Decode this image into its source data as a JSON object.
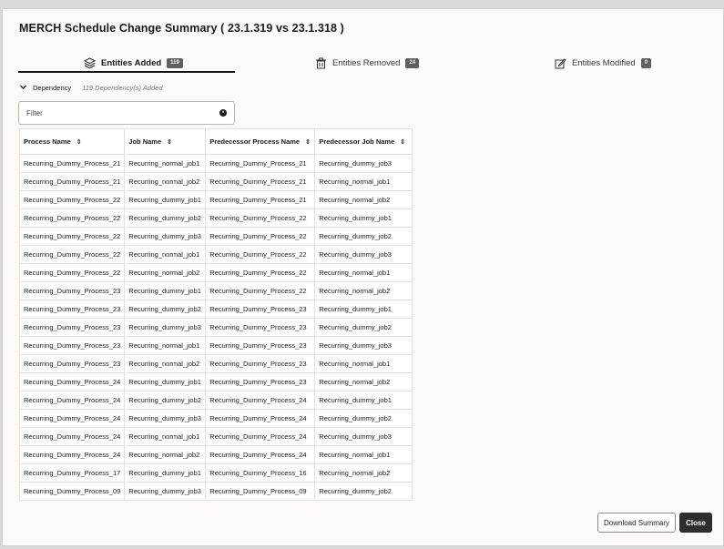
{
  "dialog": {
    "title": "MERCH Schedule Change Summary ( 23.1.319 vs 23.1.318 )"
  },
  "tabs": [
    {
      "label": "Entities Added",
      "badge": "119",
      "icon": "layers-icon",
      "active": true
    },
    {
      "label": "Entities Removed",
      "badge": "24",
      "icon": "trash-icon",
      "active": false
    },
    {
      "label": "Entities Modified",
      "badge": "0",
      "icon": "edit-icon",
      "active": false
    }
  ],
  "section": {
    "label": "Dependency",
    "count_text": "119 Dependency(s) Added",
    "icon": "chevron-down-icon"
  },
  "filter": {
    "placeholder": "Filter",
    "icon": "clear-icon"
  },
  "table": {
    "headers": [
      "Process Name",
      "Job Name",
      "Predecessor Process Name",
      "Predecessor Job Name"
    ],
    "rows": [
      [
        "Recurring_Dummy_Process_21",
        "Recurring_normal_job1",
        "Recurring_Dummy_Process_21",
        "Recurring_dummy_job3"
      ],
      [
        "Recurring_Dummy_Process_21",
        "Recurring_normal_job2",
        "Recurring_Dummy_Process_21",
        "Recurring_normal_job1"
      ],
      [
        "Recurring_Dummy_Process_22",
        "Recurring_dummy_job1",
        "Recurring_Dummy_Process_21",
        "Recurring_normal_job2"
      ],
      [
        "Recurring_Dummy_Process_22",
        "Recurring_dummy_job2",
        "Recurring_Dummy_Process_22",
        "Recurring_dummy_job1"
      ],
      [
        "Recurring_Dummy_Process_22",
        "Recurring_dummy_job3",
        "Recurring_Dummy_Process_22",
        "Recurring_dummy_job2"
      ],
      [
        "Recurring_Dummy_Process_22",
        "Recurring_normal_job1",
        "Recurring_Dummy_Process_22",
        "Recurring_dummy_job3"
      ],
      [
        "Recurring_Dummy_Process_22",
        "Recurring_normal_job2",
        "Recurring_Dummy_Process_22",
        "Recurring_normal_job1"
      ],
      [
        "Recurring_Dummy_Process_23",
        "Recurring_dummy_job1",
        "Recurring_Dummy_Process_22",
        "Recurring_normal_job2"
      ],
      [
        "Recurring_Dummy_Process_23",
        "Recurring_dummy_job2",
        "Recurring_Dummy_Process_23",
        "Recurring_dummy_job1"
      ],
      [
        "Recurring_Dummy_Process_23",
        "Recurring_dummy_job3",
        "Recurring_Dummy_Process_23",
        "Recurring_dummy_job2"
      ],
      [
        "Recurring_Dummy_Process_23",
        "Recurring_normal_job1",
        "Recurring_Dummy_Process_23",
        "Recurring_dummy_job3"
      ],
      [
        "Recurring_Dummy_Process_23",
        "Recurring_normal_job2",
        "Recurring_Dummy_Process_23",
        "Recurring_normal_job1"
      ],
      [
        "Recurring_Dummy_Process_24",
        "Recurring_dummy_job1",
        "Recurring_Dummy_Process_23",
        "Recurring_normal_job2"
      ],
      [
        "Recurring_Dummy_Process_24",
        "Recurring_dummy_job2",
        "Recurring_Dummy_Process_24",
        "Recurring_dummy_job1"
      ],
      [
        "Recurring_Dummy_Process_24",
        "Recurring_dummy_job3",
        "Recurring_Dummy_Process_24",
        "Recurring_dummy_job2"
      ],
      [
        "Recurring_Dummy_Process_24",
        "Recurring_normal_job1",
        "Recurring_Dummy_Process_24",
        "Recurring_dummy_job3"
      ],
      [
        "Recurring_Dummy_Process_24",
        "Recurring_normal_job2",
        "Recurring_Dummy_Process_24",
        "Recurring_normal_job1"
      ],
      [
        "Recurring_Dummy_Process_17",
        "Recurring_dummy_job1",
        "Recurring_Dummy_Process_16",
        "Recurring_normal_job2"
      ],
      [
        "Recurring_Dummy_Process_09",
        "Recurring_dummy_job3",
        "Recurring_Dummy_Process_09",
        "Recurring_dummy_job2"
      ]
    ]
  },
  "footer": {
    "download_label": "Download Summary",
    "close_label": "Close"
  }
}
